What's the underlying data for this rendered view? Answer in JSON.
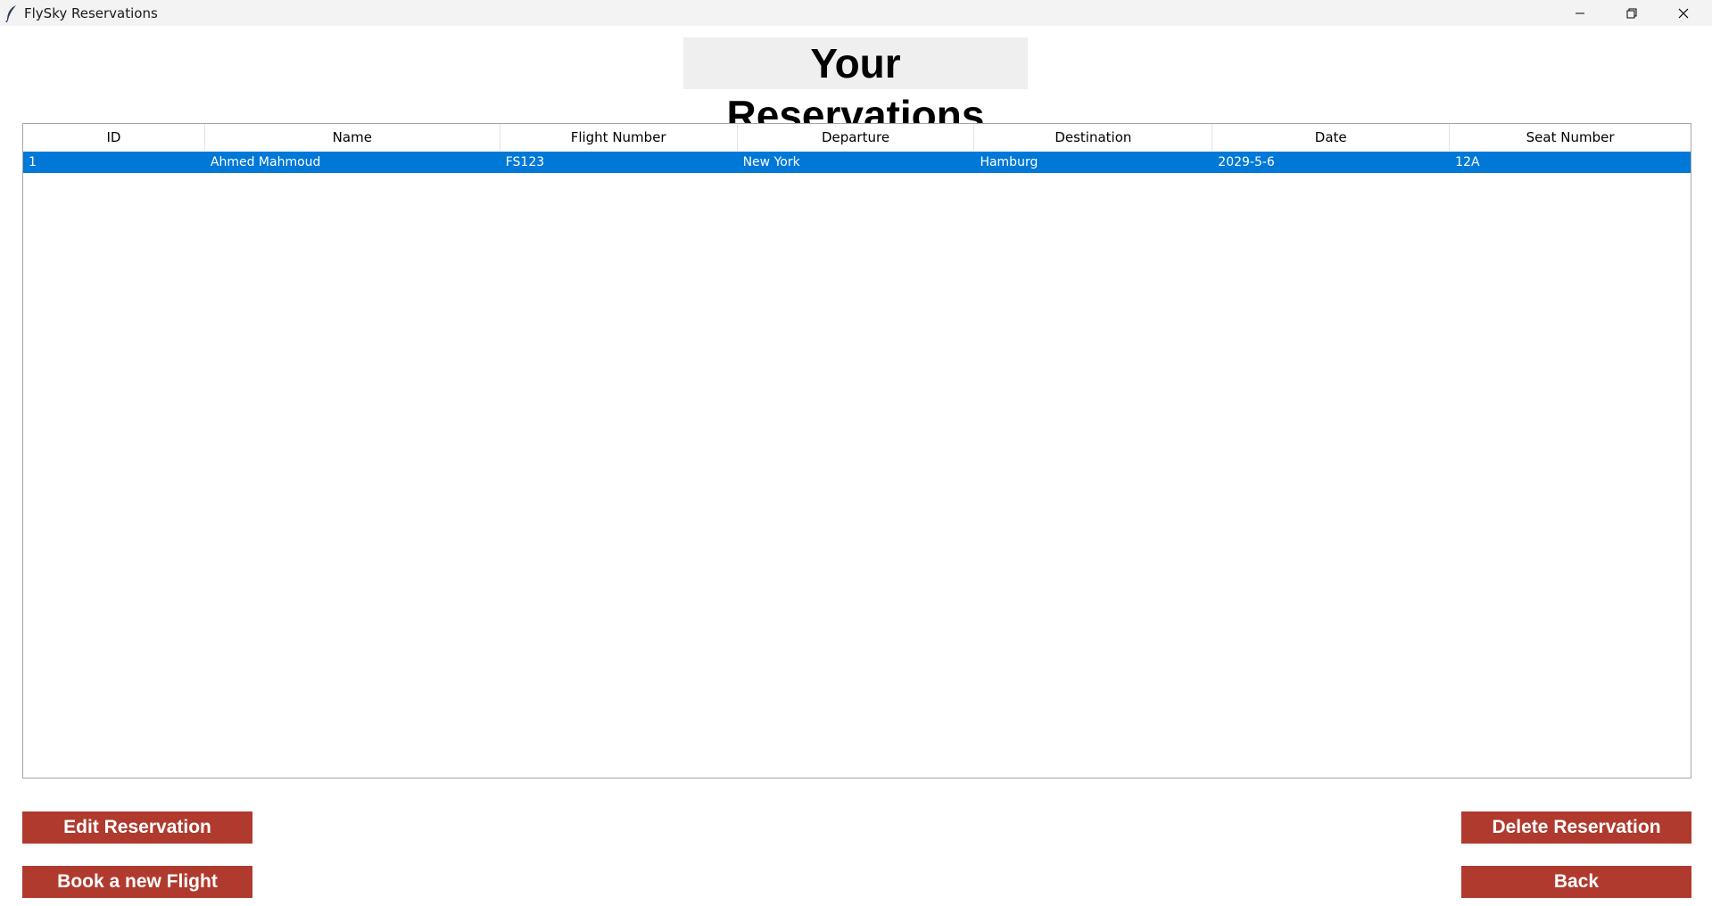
{
  "window": {
    "title": "FlySky Reservations",
    "icon": "feather-icon"
  },
  "page": {
    "title": "Your Reservations"
  },
  "table": {
    "columns": [
      "ID",
      "Name",
      "Flight Number",
      "Departure",
      "Destination",
      "Date",
      "Seat Number"
    ],
    "rows": [
      {
        "id": "1",
        "name": "Ahmed Mahmoud",
        "flight_number": "FS123",
        "departure": "New York",
        "destination": "Hamburg",
        "date": "2029-5-6",
        "seat_number": "12A",
        "selected": true
      }
    ],
    "selection_color": "#0078d7"
  },
  "buttons": {
    "edit": "Edit Reservation",
    "book": "Book a new Flight",
    "delete": "Delete Reservation",
    "back": "Back",
    "color": "#b03a2e"
  }
}
